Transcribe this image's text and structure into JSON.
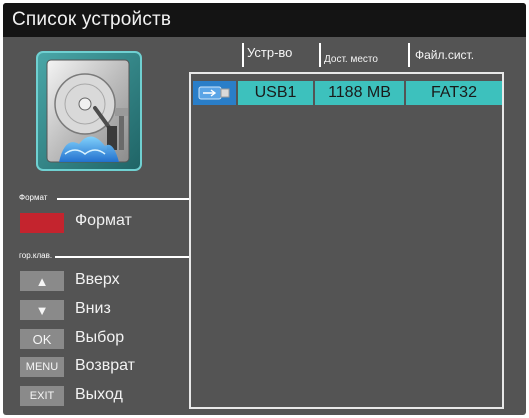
{
  "window": {
    "title": "Список устройств"
  },
  "format_section": {
    "label": "Формат",
    "button_label": "Формат",
    "button_color": "#c4242e"
  },
  "hotkeys": {
    "label": "гор.клав.",
    "items": [
      {
        "key": "▲",
        "label": "Вверх",
        "icon": "up-arrow-icon"
      },
      {
        "key": "▼",
        "label": "Вниз",
        "icon": "down-arrow-icon"
      },
      {
        "key": "OK",
        "label": "Выбор"
      },
      {
        "key": "MENU",
        "label": "Возврат"
      },
      {
        "key": "EXIT",
        "label": "Выход"
      }
    ]
  },
  "table": {
    "columns": [
      "Устр-во",
      "Дост. место",
      "Файл.сист."
    ],
    "rows": [
      {
        "icon": "usb-icon",
        "device": "USB1",
        "free_space": "1188 MB",
        "filesystem": "FAT32"
      }
    ],
    "selected_row_color": "#3dc1bd"
  },
  "illustration": {
    "icon": "hard-disk-icon"
  }
}
